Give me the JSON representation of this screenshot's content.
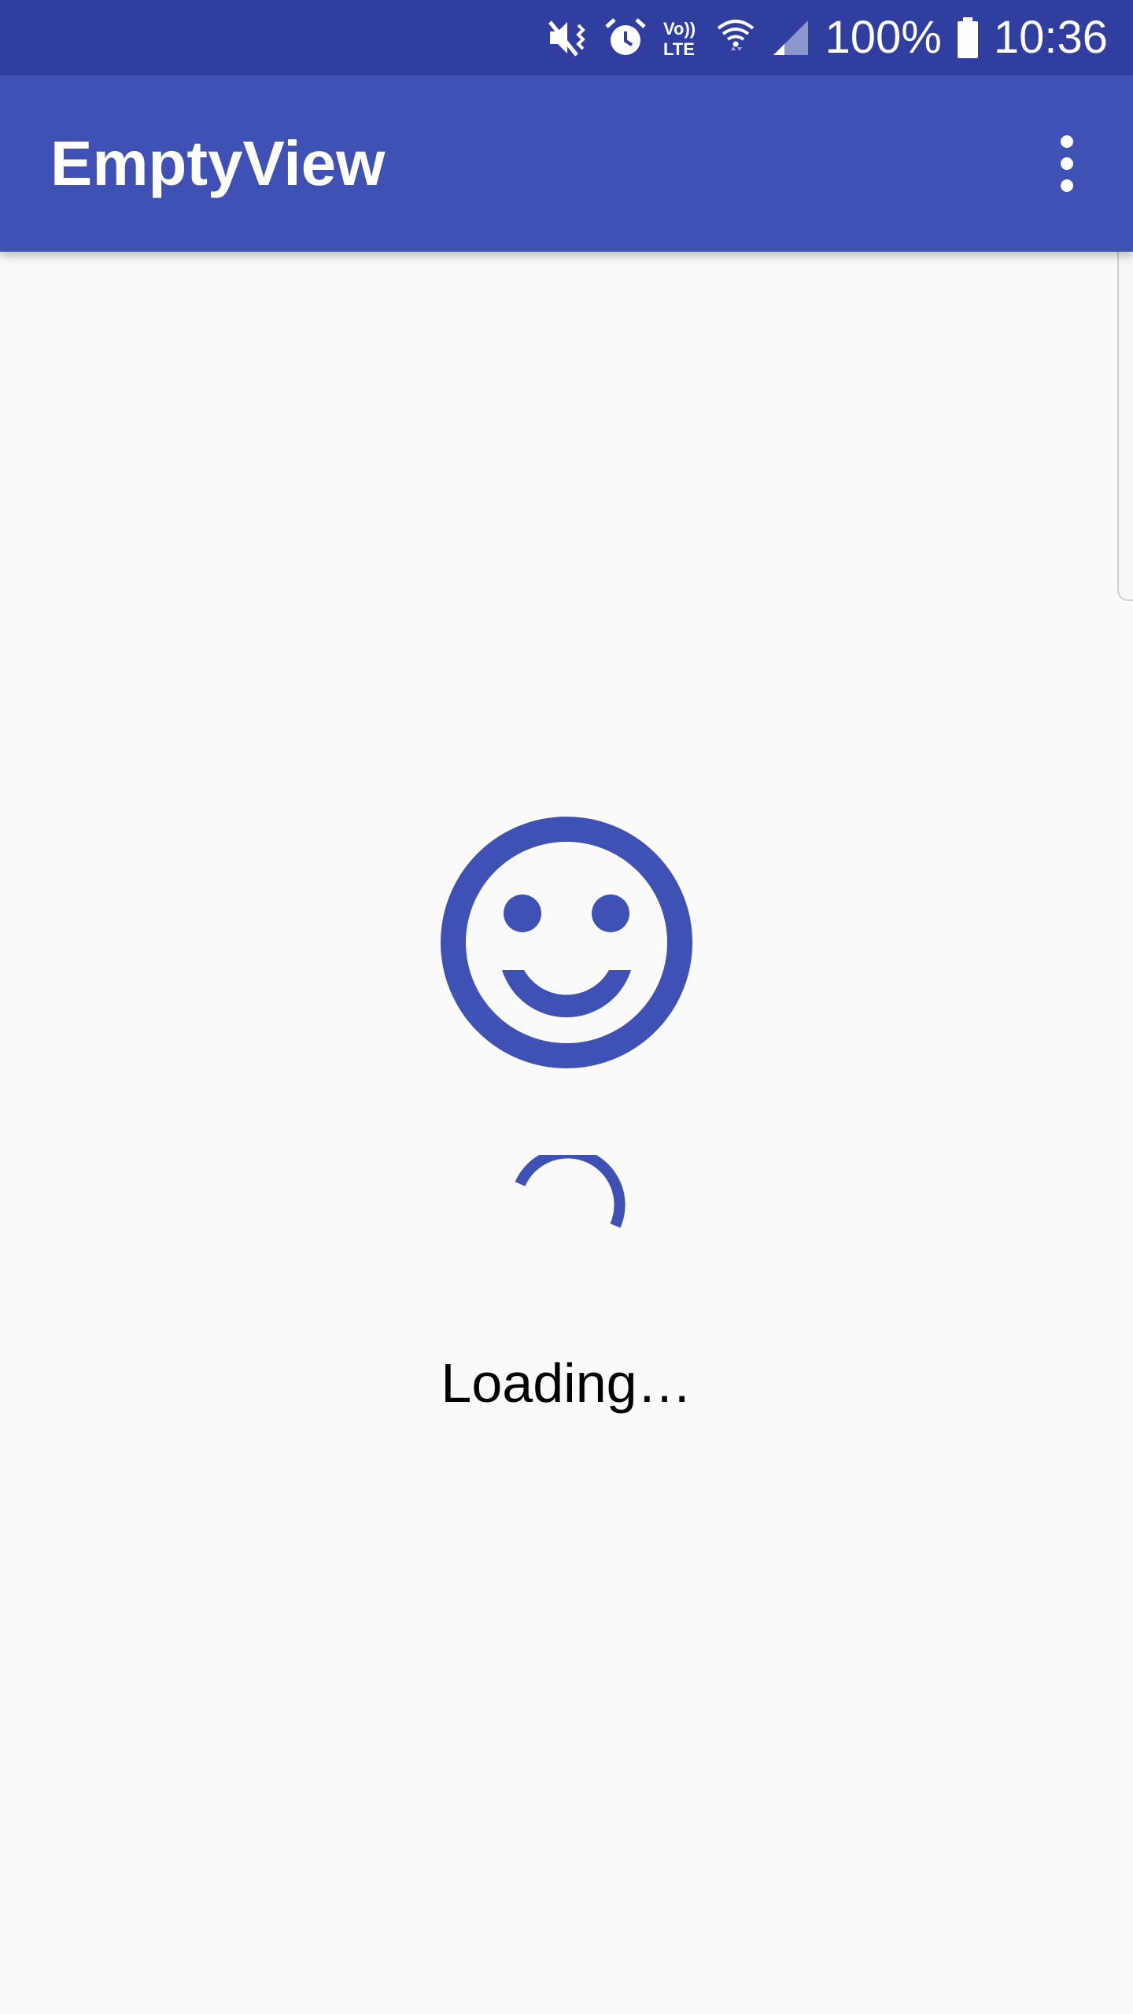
{
  "status_bar": {
    "battery_percent": "100%",
    "time": "10:36",
    "icons": [
      "mute-vibrate-icon",
      "alarm-icon",
      "volte-icon",
      "wifi-icon",
      "cell-signal-icon",
      "battery-icon"
    ],
    "volte_top": "Vo))",
    "volte_bottom": "LTE",
    "background_color": "#303f9f"
  },
  "app_bar": {
    "title": "EmptyView",
    "menu_icon": "more-vert-icon",
    "background_color": "#3f51b5"
  },
  "content": {
    "empty_icon": "smiley-icon",
    "progress_icon": "circular-progress-icon",
    "loading_label": "Loading…",
    "accent_color": "#3f51b5"
  }
}
